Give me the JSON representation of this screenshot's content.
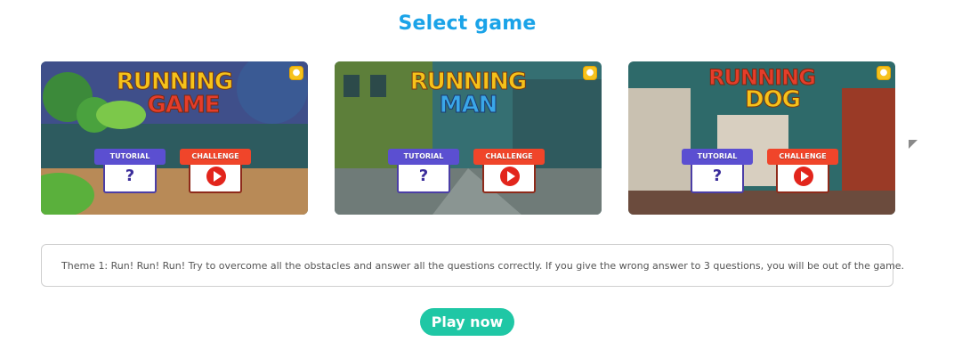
{
  "header": {
    "title": "Select game"
  },
  "games": [
    {
      "title_line1": "RUNNING",
      "title_line2": "GAME",
      "tutorial_label": "TUTORIAL",
      "challenge_label": "CHALLENGE",
      "colors": {
        "sky": "#2d5b5f",
        "ground": "#b88a57",
        "title1": "#f5c21a",
        "title2": "#e53d2a"
      }
    },
    {
      "title_line1": "RUNNING",
      "title_line2": "MAN",
      "tutorial_label": "TUTORIAL",
      "challenge_label": "CHALLENGE",
      "colors": {
        "sky": "#356f72",
        "ground": "#6f7b78",
        "title1": "#f5c21a",
        "title2": "#3aa7e8"
      }
    },
    {
      "title_line1": "RUNNING",
      "title_line2": "DOG",
      "tutorial_label": "TUTORIAL",
      "challenge_label": "CHALLENGE",
      "colors": {
        "sky": "#2e6a6a",
        "ground": "#6b4b3d",
        "title1": "#e53d2a",
        "title2": "#f5c21a"
      }
    }
  ],
  "description": {
    "text": "Theme 1: Run! Run! Run! Try to overcome all the obstacles and answer all the questions correctly. If you give the wrong answer to 3 questions, you will be out of the game."
  },
  "actions": {
    "play_label": "Play now"
  },
  "colors": {
    "title_blue": "#1aa3e8",
    "play_green": "#1fc7a5",
    "tutorial_purple": "#5b4fd1",
    "challenge_red": "#f0452a"
  }
}
